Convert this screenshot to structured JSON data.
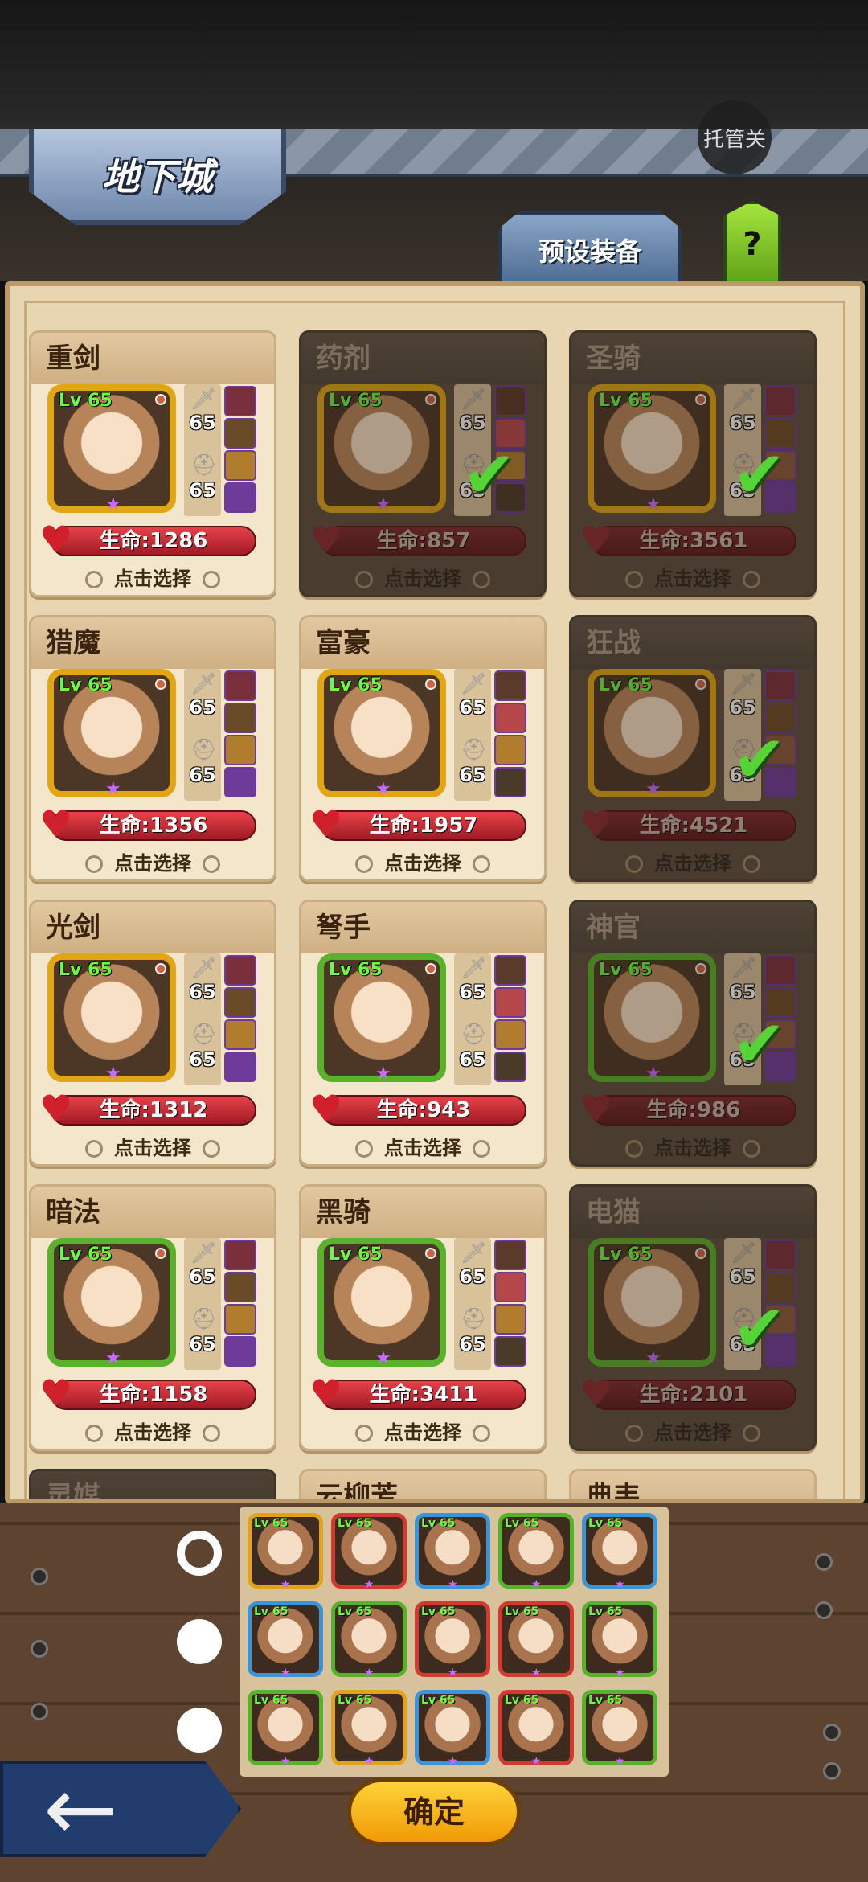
{
  "header": {
    "title": "地下城",
    "auto_label": "托管关",
    "preset_tab": "预设装备",
    "help_label": "?"
  },
  "cards": [
    {
      "name": "重剑",
      "level": "Lv 65",
      "stat1": "65",
      "stat2": "65",
      "hp": "生命:1286",
      "select": "点击选择",
      "selected": false,
      "frame": "gold"
    },
    {
      "name": "药剂",
      "level": "Lv 65",
      "stat1": "65",
      "stat2": "65",
      "hp": "生命:857",
      "select": "点击选择",
      "selected": true,
      "frame": "gold"
    },
    {
      "name": "圣骑",
      "level": "Lv 65",
      "stat1": "65",
      "stat2": "65",
      "hp": "生命:3561",
      "select": "点击选择",
      "selected": true,
      "frame": "gold"
    },
    {
      "name": "猎魔",
      "level": "Lv 65",
      "stat1": "65",
      "stat2": "65",
      "hp": "生命:1356",
      "select": "点击选择",
      "selected": false,
      "frame": "gold"
    },
    {
      "name": "富豪",
      "level": "Lv 65",
      "stat1": "65",
      "stat2": "65",
      "hp": "生命:1957",
      "select": "点击选择",
      "selected": false,
      "frame": "gold"
    },
    {
      "name": "狂战",
      "level": "Lv 65",
      "stat1": "65",
      "stat2": "65",
      "hp": "生命:4521",
      "select": "点击选择",
      "selected": true,
      "frame": "gold"
    },
    {
      "name": "光剑",
      "level": "Lv 65",
      "stat1": "65",
      "stat2": "65",
      "hp": "生命:1312",
      "select": "点击选择",
      "selected": false,
      "frame": "gold"
    },
    {
      "name": "弩手",
      "level": "Lv 65",
      "stat1": "65",
      "stat2": "65",
      "hp": "生命:943",
      "select": "点击选择",
      "selected": false,
      "frame": "green"
    },
    {
      "name": "神官",
      "level": "Lv 65",
      "stat1": "65",
      "stat2": "65",
      "hp": "生命:986",
      "select": "点击选择",
      "selected": true,
      "frame": "green"
    },
    {
      "name": "暗法",
      "level": "Lv 65",
      "stat1": "65",
      "stat2": "65",
      "hp": "生命:1158",
      "select": "点击选择",
      "selected": false,
      "frame": "green"
    },
    {
      "name": "黑骑",
      "level": "Lv 65",
      "stat1": "65",
      "stat2": "65",
      "hp": "生命:3411",
      "select": "点击选择",
      "selected": false,
      "frame": "green"
    },
    {
      "name": "电猫",
      "level": "Lv 65",
      "stat1": "65",
      "stat2": "65",
      "hp": "生命:2101",
      "select": "点击选择",
      "selected": true,
      "frame": "green"
    }
  ],
  "partial_cards": [
    "灵媒",
    "云柳芳",
    "典韦"
  ],
  "teams": {
    "rows": [
      {
        "selected": true,
        "frames": [
          "gold",
          "red",
          "blue",
          "green",
          "blue"
        ]
      },
      {
        "selected": false,
        "frames": [
          "blue",
          "green",
          "red",
          "red",
          "green"
        ]
      },
      {
        "selected": false,
        "frames": [
          "green",
          "gold",
          "blue",
          "red",
          "green"
        ]
      }
    ],
    "mini_level": "Lv 65"
  },
  "footer": {
    "back_icon": "←",
    "confirm_label": "确定"
  },
  "colors": {
    "gold_frame": "#e2a615",
    "green_frame": "#59b12c",
    "check": "#56d437",
    "hp_red": "#d0202c"
  }
}
